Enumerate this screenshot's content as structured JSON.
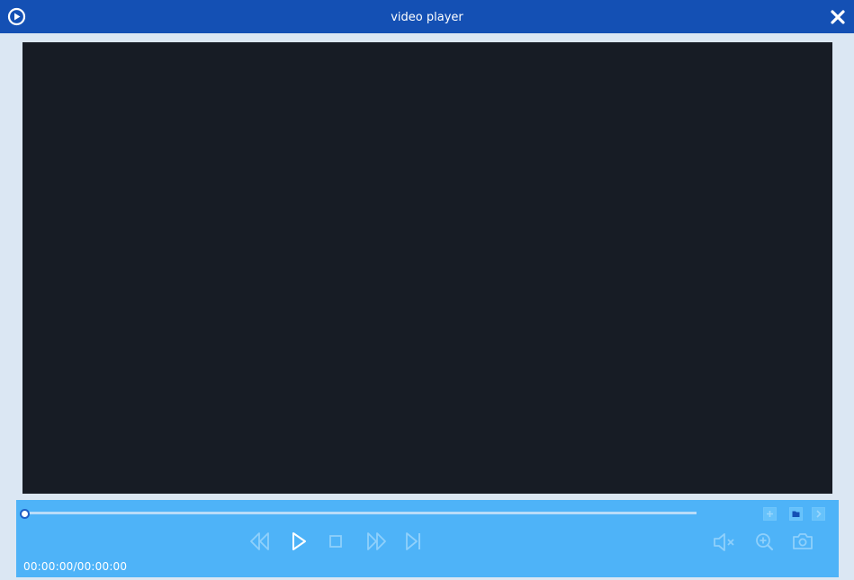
{
  "window": {
    "title": "video player"
  },
  "player": {
    "time_display": "00:00:00/00:00:00",
    "progress": 0
  },
  "icons": {
    "app": "play-circle-icon",
    "close": "close-icon",
    "rewind": "rewind-icon",
    "play": "play-icon",
    "stop": "stop-icon",
    "fast_forward": "fast-forward-icon",
    "next_frame": "next-frame-icon",
    "mute": "mute-icon",
    "zoom": "zoom-in-icon",
    "snapshot": "camera-icon",
    "mini_add": "plus-icon",
    "mini_folder": "folder-icon",
    "mini_next": "chevron-right-icon"
  },
  "colors": {
    "titlebar": "#1450b4",
    "control_bar": "#4eb3f8",
    "video_bg": "#171c25",
    "active_icon": "#ffffff",
    "inactive_icon": "#8fd0fb"
  }
}
